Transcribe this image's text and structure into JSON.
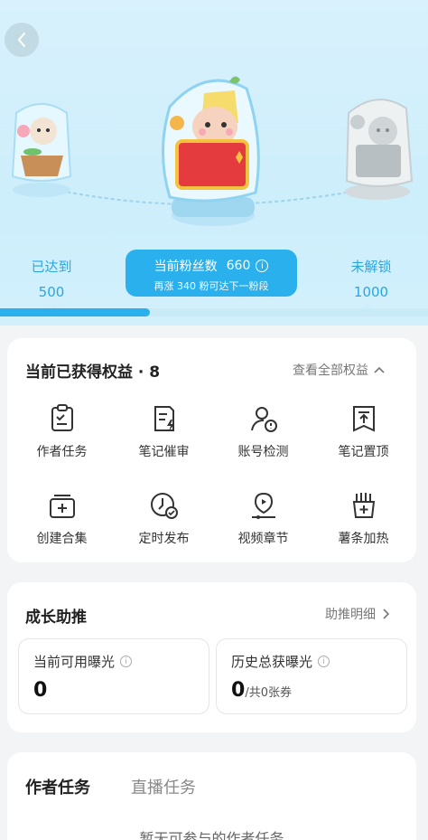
{
  "header": {
    "back_icon": "chevron-left-icon"
  },
  "stages": {
    "reached": {
      "label": "已达到",
      "value": "500"
    },
    "current": {
      "label": "当前粉丝数",
      "value": "660",
      "hint": "再涨 340 粉可达下一粉段"
    },
    "locked": {
      "label": "未解锁",
      "value": "1000"
    }
  },
  "progress": {
    "fraction": 0.35
  },
  "benefits": {
    "title": "当前已获得权益 · 8",
    "view_all": "查看全部权益",
    "items": [
      {
        "label": "作者任务",
        "icon": "task-clipboard-icon"
      },
      {
        "label": "笔记催审",
        "icon": "note-lightning-icon"
      },
      {
        "label": "账号检测",
        "icon": "account-check-icon"
      },
      {
        "label": "笔记置顶",
        "icon": "pin-top-icon"
      },
      {
        "label": "创建合集",
        "icon": "collection-add-icon"
      },
      {
        "label": "定时发布",
        "icon": "clock-check-icon"
      },
      {
        "label": "视频章节",
        "icon": "video-chapter-icon"
      },
      {
        "label": "薯条加热",
        "icon": "fries-boost-icon"
      }
    ]
  },
  "growth": {
    "title": "成长助推",
    "detail_link": "助推明细",
    "available": {
      "label": "当前可用曝光",
      "value": "0"
    },
    "history": {
      "label": "历史总获曝光",
      "value": "0",
      "suffix": "/共0张券"
    }
  },
  "tasks": {
    "tab_author": "作者任务",
    "tab_live": "直播任务",
    "empty_text": "暂无可参与的作者任务"
  },
  "colors": {
    "accent": "#2bb0ee",
    "hero_bg": "#d2f0fc"
  }
}
